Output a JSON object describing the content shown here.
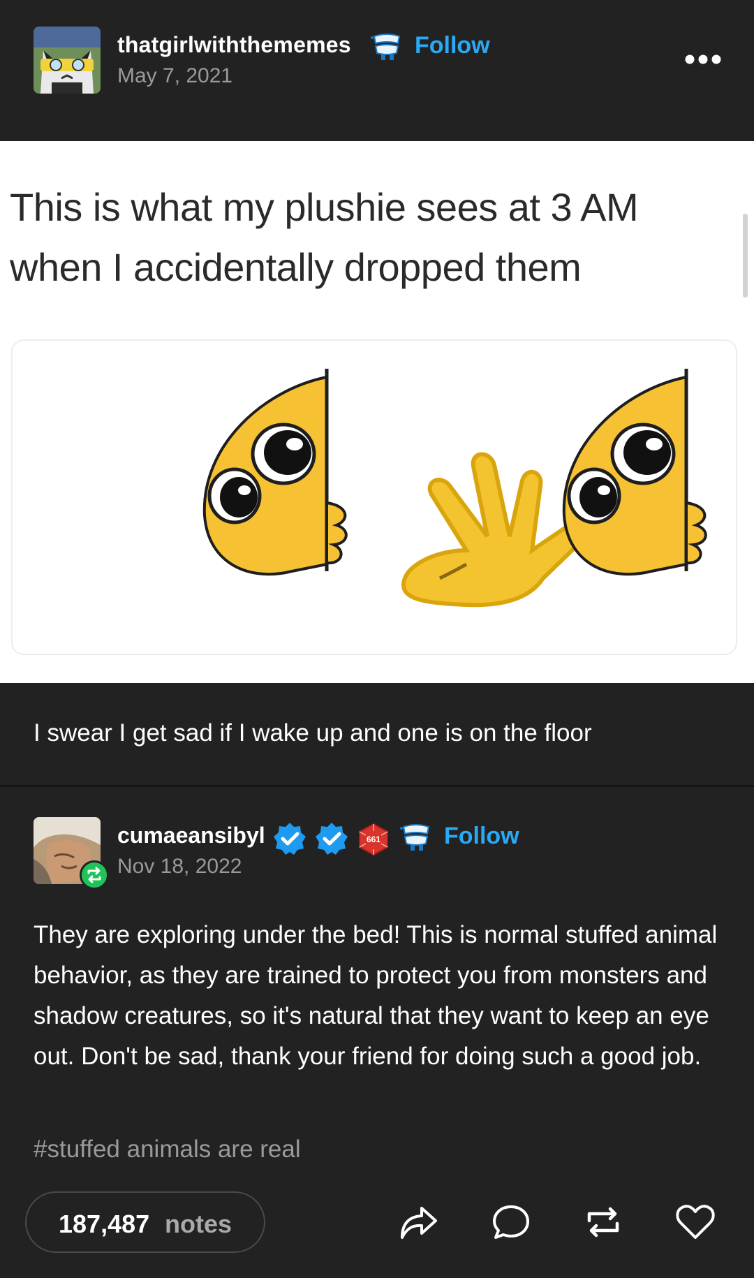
{
  "post": {
    "username": "thatgirlwiththememes",
    "follow_label": "Follow",
    "date": "May 7, 2021",
    "avatar_icon": "cat-sunglasses-avatar",
    "badge_icon": "teeth-badge-icon",
    "menu_icon": "more-icon"
  },
  "meme": {
    "line1": "This is what my plushie sees at 3 AM",
    "line2": "when I accidentally dropped them"
  },
  "caption": "I swear I get sad if I wake up and one is on the floor",
  "reblog": {
    "username": "cumaeansibyl",
    "follow_label": "Follow",
    "date": "Nov 18, 2022",
    "badge_number": "661",
    "body": "They are exploring under the bed! This is normal stuffed animal behavior, as they are trained to protect you from monsters and shadow creatures, so it's natural that they want to keep an eye out. Don't be sad, thank your friend for doing such a good job.",
    "tag": "#stuffed animals are real"
  },
  "footer": {
    "notes_count": "187,487",
    "notes_label": "notes",
    "actions": [
      "share-icon",
      "reply-icon",
      "reblog-icon",
      "like-icon"
    ]
  },
  "colors": {
    "background": "#222222",
    "accent": "#2aa9f4",
    "muted": "#9a9a9a",
    "reblog_green": "#1fc35a",
    "verified_blue": "#1d9bf0",
    "badge_red": "#d9342b"
  }
}
